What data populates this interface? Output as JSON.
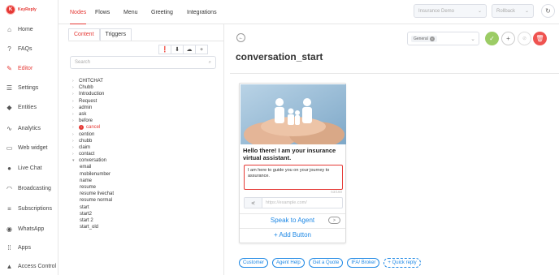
{
  "brand": {
    "logo_letter": "K",
    "name": "KeyReply",
    "accent": "#e53935"
  },
  "sidebar": {
    "items": [
      {
        "label": "Home",
        "icon": "home-icon",
        "glyph": "⌂"
      },
      {
        "label": "FAQs",
        "icon": "help-circle-icon",
        "glyph": "?"
      },
      {
        "label": "Editor",
        "icon": "edit-icon",
        "glyph": "✎"
      },
      {
        "label": "Settings",
        "icon": "settings-icon",
        "glyph": "☰"
      },
      {
        "label": "Entities",
        "icon": "tag-icon",
        "glyph": "◆"
      },
      {
        "label": "Analytics",
        "icon": "pulse-icon",
        "glyph": "∿"
      },
      {
        "label": "Web widget",
        "icon": "monitor-icon",
        "glyph": "▭"
      },
      {
        "label": "Live Chat",
        "icon": "chat-icon",
        "glyph": "●"
      },
      {
        "label": "Broadcasting",
        "icon": "rss-icon",
        "glyph": "◠"
      },
      {
        "label": "Subscriptions",
        "icon": "list-icon",
        "glyph": "≡"
      },
      {
        "label": "WhatsApp",
        "icon": "whatsapp-icon",
        "glyph": "◉"
      },
      {
        "label": "Apps",
        "icon": "apps-icon",
        "glyph": "⁞⁞"
      },
      {
        "label": "Access Control",
        "icon": "warning-icon",
        "glyph": "▲"
      }
    ]
  },
  "topbar": {
    "tabs": [
      "Nodes",
      "Flows",
      "Menu",
      "Greeting",
      "Integrations"
    ],
    "demo_select": "Insurance Demo",
    "rollback_select": "Rollback"
  },
  "tree_panel": {
    "tabs": [
      "Content",
      "Triggers"
    ],
    "tool_glyphs": [
      "❗",
      "⬇",
      "☁",
      "+"
    ],
    "search_placeholder": "Search",
    "items": [
      {
        "label": "CHITCHAT",
        "type": "parent"
      },
      {
        "label": "Chubb",
        "type": "parent"
      },
      {
        "label": "Introduction",
        "type": "parent"
      },
      {
        "label": "Request",
        "type": "parent"
      },
      {
        "label": "admin",
        "type": "parent"
      },
      {
        "label": "ask",
        "type": "parent"
      },
      {
        "label": "before",
        "type": "parent"
      },
      {
        "label": "cancel",
        "type": "error"
      },
      {
        "label": "cention",
        "type": "parent"
      },
      {
        "label": "chubb",
        "type": "parent"
      },
      {
        "label": "claim",
        "type": "parent"
      },
      {
        "label": "contact",
        "type": "parent"
      },
      {
        "label": "conversation",
        "type": "open"
      },
      {
        "label": "email",
        "type": "child"
      },
      {
        "label": "mobilenumber",
        "type": "child"
      },
      {
        "label": "name",
        "type": "child"
      },
      {
        "label": "resume",
        "type": "child"
      },
      {
        "label": "resume livechat",
        "type": "child"
      },
      {
        "label": "resume normal",
        "type": "child"
      },
      {
        "label": "start",
        "type": "child"
      },
      {
        "label": "start2",
        "type": "child"
      },
      {
        "label": "start 2",
        "type": "child"
      },
      {
        "label": "start_old",
        "type": "child"
      }
    ]
  },
  "editor": {
    "node_title": "conversation_start",
    "tag": "General",
    "card": {
      "title": "Hello there! I am your insurance virtual assistant.",
      "body": "I am here to guide you on your journey to assurance.",
      "char_count": "53/160",
      "url_placeholder": "https://example.com/",
      "button_label": "Speak to Agent",
      "add_button_label": "+ Add Button"
    },
    "quick_replies": [
      "Customer",
      "Agent Help",
      "Get a Quote",
      "IFA/ Broker"
    ],
    "add_quick_reply": "+ Quick reply"
  }
}
